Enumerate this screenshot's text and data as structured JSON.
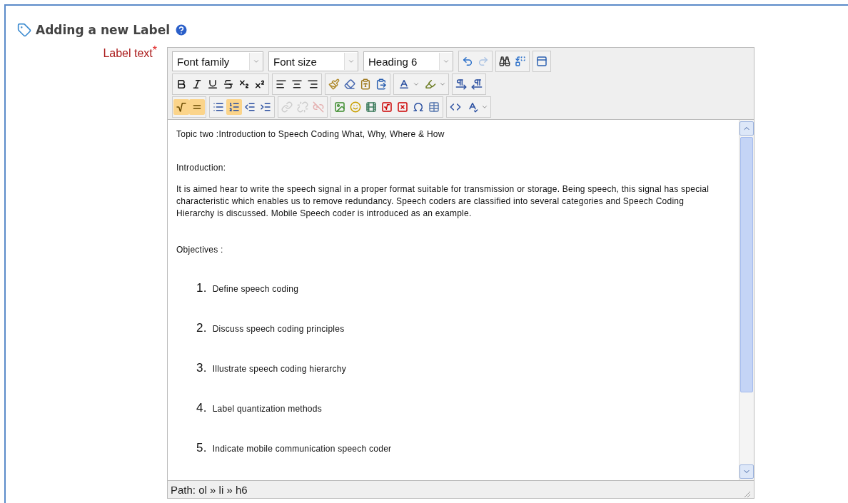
{
  "heading": {
    "title": "Adding a new Label"
  },
  "field": {
    "label": "Label text",
    "required_mark": "*"
  },
  "editor": {
    "selects": [
      {
        "value": "Font family"
      },
      {
        "value": "Font size"
      },
      {
        "value": "Heading 6"
      }
    ],
    "toolbar": [
      [
        [
          {
            "active": false,
            "disabled": false
          },
          {
            "active": false,
            "disabled": true
          }
        ],
        [
          {
            "active": false,
            "disabled": false
          },
          {
            "active": false,
            "disabled": false
          }
        ],
        [
          {
            "active": false,
            "disabled": false
          }
        ]
      ],
      [
        [
          {
            "active": false,
            "disabled": false
          },
          {
            "active": false,
            "disabled": false
          },
          {
            "active": false,
            "disabled": false
          },
          {
            "active": false,
            "disabled": false
          },
          {
            "active": false,
            "disabled": false
          },
          {
            "active": false,
            "disabled": false
          }
        ],
        [
          {
            "active": false,
            "disabled": false
          },
          {
            "active": false,
            "disabled": false
          },
          {
            "active": false,
            "disabled": false
          }
        ],
        [
          {
            "active": false,
            "disabled": false
          },
          {
            "active": false,
            "disabled": false
          },
          {
            "active": false,
            "disabled": false
          },
          {
            "active": false,
            "disabled": false
          }
        ],
        [
          {
            "active": false,
            "disabled": false
          },
          {
            "active": false,
            "disabled": false
          }
        ],
        [
          {
            "active": false,
            "disabled": false
          },
          {
            "active": false,
            "disabled": false
          }
        ]
      ],
      [
        [
          {
            "active": true,
            "disabled": false
          },
          {
            "active": true,
            "disabled": false
          }
        ],
        [
          {
            "active": false,
            "disabled": false
          },
          {
            "active": true,
            "disabled": false
          },
          {
            "active": false,
            "disabled": false
          },
          {
            "active": false,
            "disabled": false
          }
        ],
        [
          {
            "active": false,
            "disabled": true
          },
          {
            "active": false,
            "disabled": true
          },
          {
            "active": false,
            "disabled": true
          }
        ],
        [
          {
            "active": false,
            "disabled": false
          },
          {
            "active": false,
            "disabled": false
          },
          {
            "active": false,
            "disabled": false
          },
          {
            "active": false,
            "disabled": false
          },
          {
            "active": false,
            "disabled": false
          },
          {
            "active": false,
            "disabled": false
          },
          {
            "active": false,
            "disabled": false
          }
        ],
        [
          {
            "active": false,
            "disabled": false
          },
          {
            "active": false,
            "disabled": false
          }
        ]
      ]
    ],
    "content": {
      "title": "Topic two :Introduction to Speech Coding What, Why, Where & How",
      "intro_heading": "Introduction:",
      "intro_text": "It is aimed hear to write the speech signal in a proper format suitable for transmission or storage. Being speech, this signal has special characteristic which  enables us to remove redundancy. Speech coders are classified into several categories and Speech Coding Hierarchy is discussed. Mobile Speech coder is introduced as an example.",
      "objectives_heading": "Objectives :",
      "objectives": [
        {
          "number": "1.",
          "text": "Define speech coding"
        },
        {
          "number": "2.",
          "text": "Discuss speech coding principles"
        },
        {
          "number": "3.",
          "text": "Illustrate speech coding hierarchy"
        },
        {
          "number": "4.",
          "text": "Label quantization methods"
        },
        {
          "number": "5.",
          "text": "Indicate mobile communication speech coder"
        }
      ]
    },
    "path": "Path: ol » li » h6"
  }
}
